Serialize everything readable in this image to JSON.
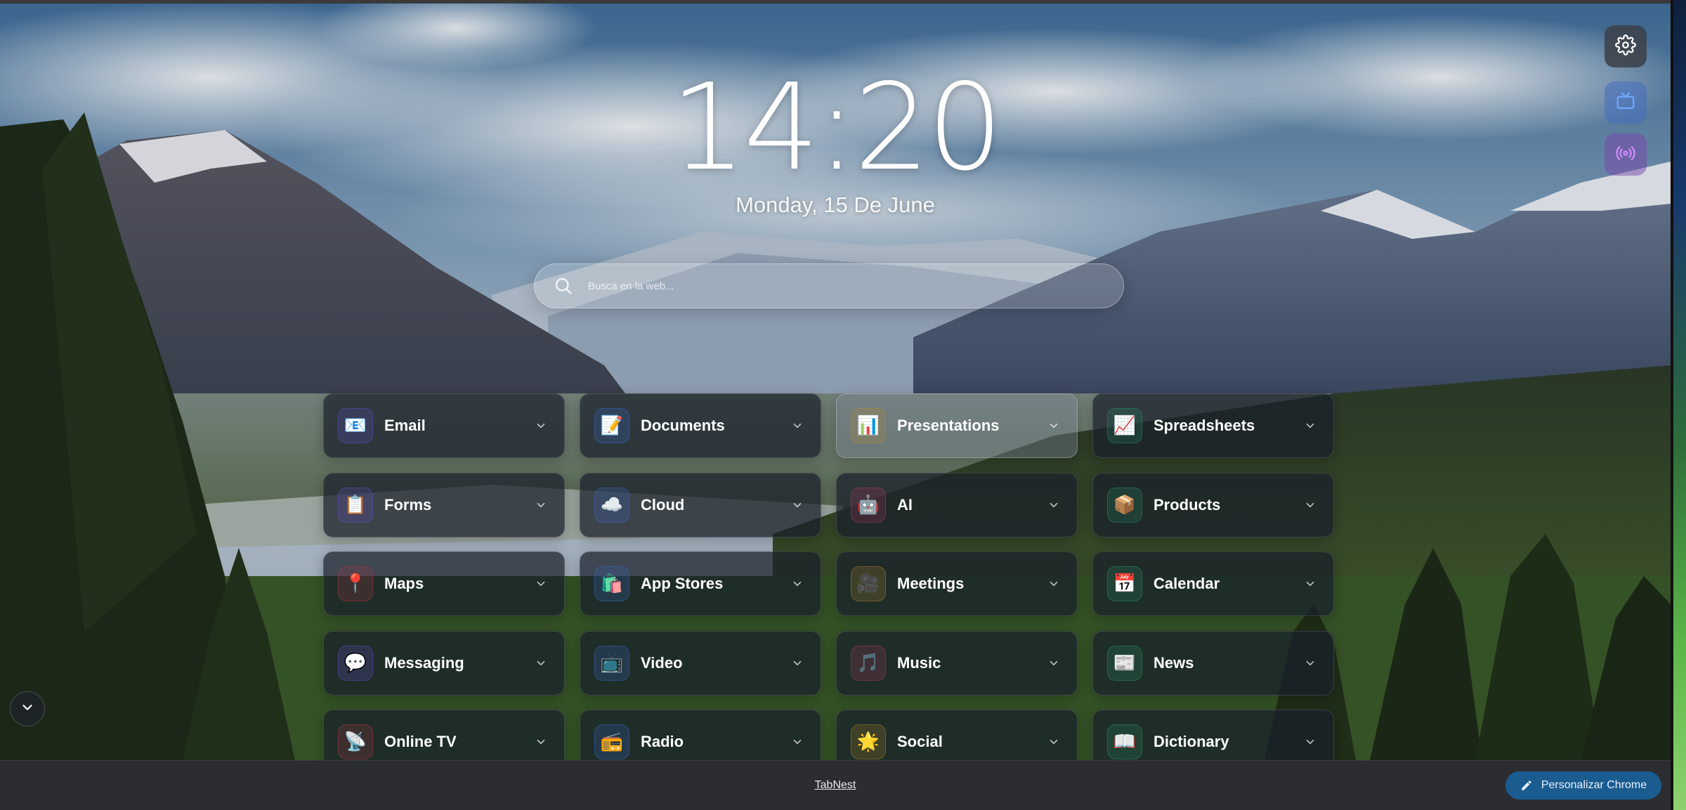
{
  "clock": {
    "time": "14:20",
    "date": "Monday, 15 De June"
  },
  "search": {
    "placeholder": "Busca en la web..."
  },
  "side_buttons": [
    {
      "name": "settings",
      "icon": "gear-icon"
    },
    {
      "name": "tv",
      "icon": "tv-icon"
    },
    {
      "name": "radio",
      "icon": "broadcast-icon"
    }
  ],
  "categories": [
    {
      "label": "Email",
      "icon": "📧",
      "color": "#6b4fd8"
    },
    {
      "label": "Documents",
      "icon": "📝",
      "color": "#3b6fd8"
    },
    {
      "label": "Presentations",
      "icon": "📊",
      "color": "#c08a2a"
    },
    {
      "label": "Spreadsheets",
      "icon": "📈",
      "color": "#2a9d6f"
    },
    {
      "label": "Forms",
      "icon": "📋",
      "color": "#6b4fd8"
    },
    {
      "label": "Cloud",
      "icon": "☁️",
      "color": "#3b6fd8"
    },
    {
      "label": "AI",
      "icon": "🤖",
      "color": "#c0396b"
    },
    {
      "label": "Products",
      "icon": "📦",
      "color": "#2a9d6f"
    },
    {
      "label": "Maps",
      "icon": "📍",
      "color": "#c0394b"
    },
    {
      "label": "App Stores",
      "icon": "🛍️",
      "color": "#3b6fd8"
    },
    {
      "label": "Meetings",
      "icon": "🎥",
      "color": "#c08a2a"
    },
    {
      "label": "Calendar",
      "icon": "📅",
      "color": "#2a9d6f"
    },
    {
      "label": "Messaging",
      "icon": "💬",
      "color": "#6b4fd8"
    },
    {
      "label": "Video",
      "icon": "📺",
      "color": "#3b6fd8"
    },
    {
      "label": "Music",
      "icon": "🎵",
      "color": "#c0396b"
    },
    {
      "label": "News",
      "icon": "📰",
      "color": "#2a9d6f"
    },
    {
      "label": "Online TV",
      "icon": "📡",
      "color": "#c0394b"
    },
    {
      "label": "Radio",
      "icon": "📻",
      "color": "#3b6fd8"
    },
    {
      "label": "Social",
      "icon": "🌟",
      "color": "#c08a2a"
    },
    {
      "label": "Dictionary",
      "icon": "📖",
      "color": "#2a9d6f"
    }
  ],
  "footer": {
    "link_text": "TabNest",
    "customize_label": "Personalizar Chrome"
  }
}
